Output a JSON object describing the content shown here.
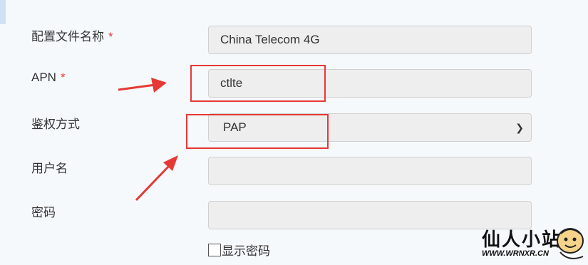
{
  "form": {
    "profile_name": {
      "label": "配置文件名称",
      "required_mark": "*",
      "value": "China Telecom 4G"
    },
    "apn": {
      "label": "APN",
      "required_mark": "*",
      "value": "ctlte"
    },
    "auth_method": {
      "label": "鉴权方式",
      "value": "PAP",
      "chevron_icon": "chevron-down-icon"
    },
    "username": {
      "label": "用户名",
      "value": ""
    },
    "password": {
      "label": "密码",
      "value": ""
    },
    "show_password": {
      "label": "显示密码",
      "checked": false
    }
  },
  "watermark": {
    "title": "仙人小站",
    "url": "WWW.WRNXR.CN"
  },
  "colors": {
    "annotation": "#e53935",
    "field_bg": "#eeeeee",
    "page_bg": "#f6f9fc"
  }
}
